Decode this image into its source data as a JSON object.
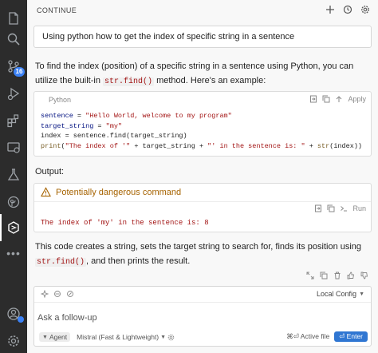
{
  "activity_bar": {
    "icons": [
      "files-icon",
      "search-icon",
      "source-control-icon",
      "run-debug-icon",
      "extensions-icon",
      "remote-explorer-icon",
      "testing-icon",
      "gitlens-icon",
      "continue-icon"
    ],
    "badge_count": "16",
    "more": "•••"
  },
  "panel": {
    "title": "CONTINUE",
    "user_message": "Using python how to get the index of specific string in a sentence",
    "answer": {
      "intro_before": "To find the index (position) of a specific string in a sentence using Python, you can utilize the built-in ",
      "intro_code": "str.find()",
      "intro_after": " method. Here's an example:",
      "code_block": {
        "language": "Python",
        "apply_label": "Apply",
        "lines": {
          "l1": {
            "var": "sentence",
            "op": " = ",
            "str": "\"Hello World, welcome to my program\""
          },
          "l2": {
            "var": "target_string",
            "op": " = ",
            "str": "\"my\""
          },
          "l3": {
            "text": "index = sentence.find(target_string)"
          },
          "l4": {
            "fn": "print",
            "open": "(",
            "s1": "\"The index of '\"",
            "mid1": " + target_string + ",
            "s2": "\"' in the sentence is: \"",
            "mid2": " + ",
            "fn2": "str",
            "rest": "(index))"
          }
        }
      },
      "output_label": "Output:",
      "danger_block": {
        "title": "Potentially dangerous command",
        "run_label": "Run",
        "output": "The index of 'my' in the sentence is: 8"
      },
      "outro_before": "This code creates a string, sets the target string to search for, finds its position using ",
      "outro_code": "str.find()",
      "outro_after": ", and then prints the result."
    },
    "input": {
      "config_label": "Local Config",
      "placeholder": "Ask a follow-up",
      "mode_label": "Agent",
      "model_label": "Mistral (Fast & Lightweight)",
      "active_file_shortcut": "⌘⏎ Active file",
      "enter_label": "⏎ Enter"
    }
  },
  "colors": {
    "activity_bar_bg": "#2c2c2c",
    "accent": "#2f76d2",
    "warning": "#a66300",
    "code_string": "#a31515"
  }
}
